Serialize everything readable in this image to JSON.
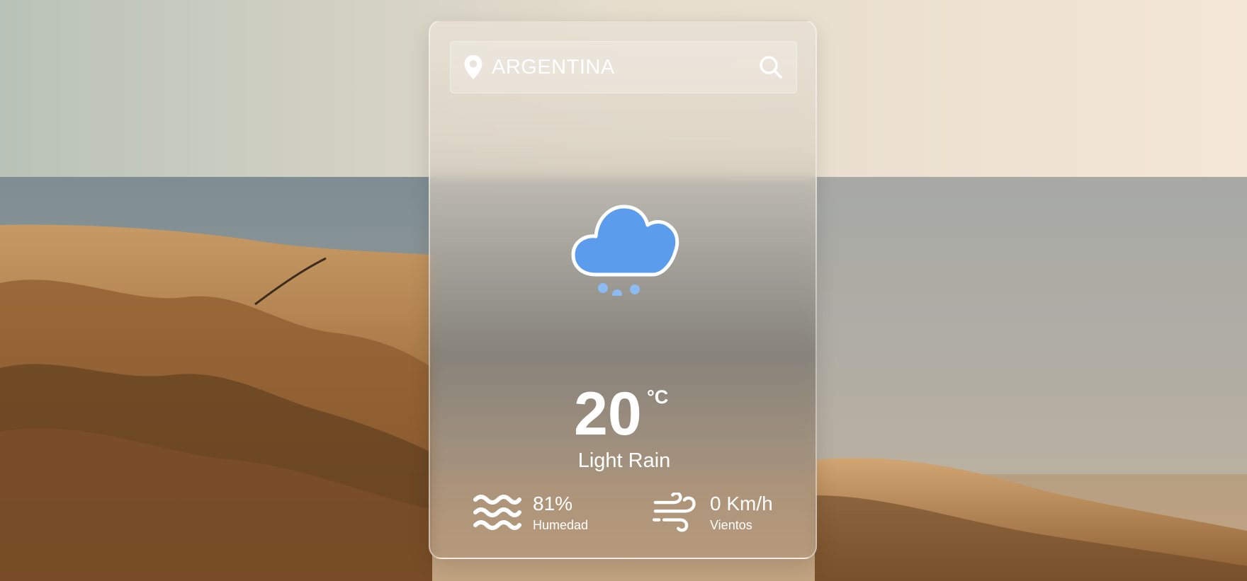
{
  "search": {
    "value": "ARGENTINA",
    "placeholder": "",
    "location_icon": "map-pin-icon",
    "search_icon": "search-icon"
  },
  "weather": {
    "icon": "light-rain-icon",
    "temperature": "20",
    "unit": "°C",
    "description": "Light Rain"
  },
  "stats": {
    "humidity": {
      "icon": "humidity-waves-icon",
      "value": "81%",
      "label": "Humedad"
    },
    "wind": {
      "icon": "wind-icon",
      "value": "0 Km/h",
      "label": "Vientos"
    }
  },
  "colors": {
    "cloud": "#5b9ced",
    "text": "#ffffff"
  }
}
